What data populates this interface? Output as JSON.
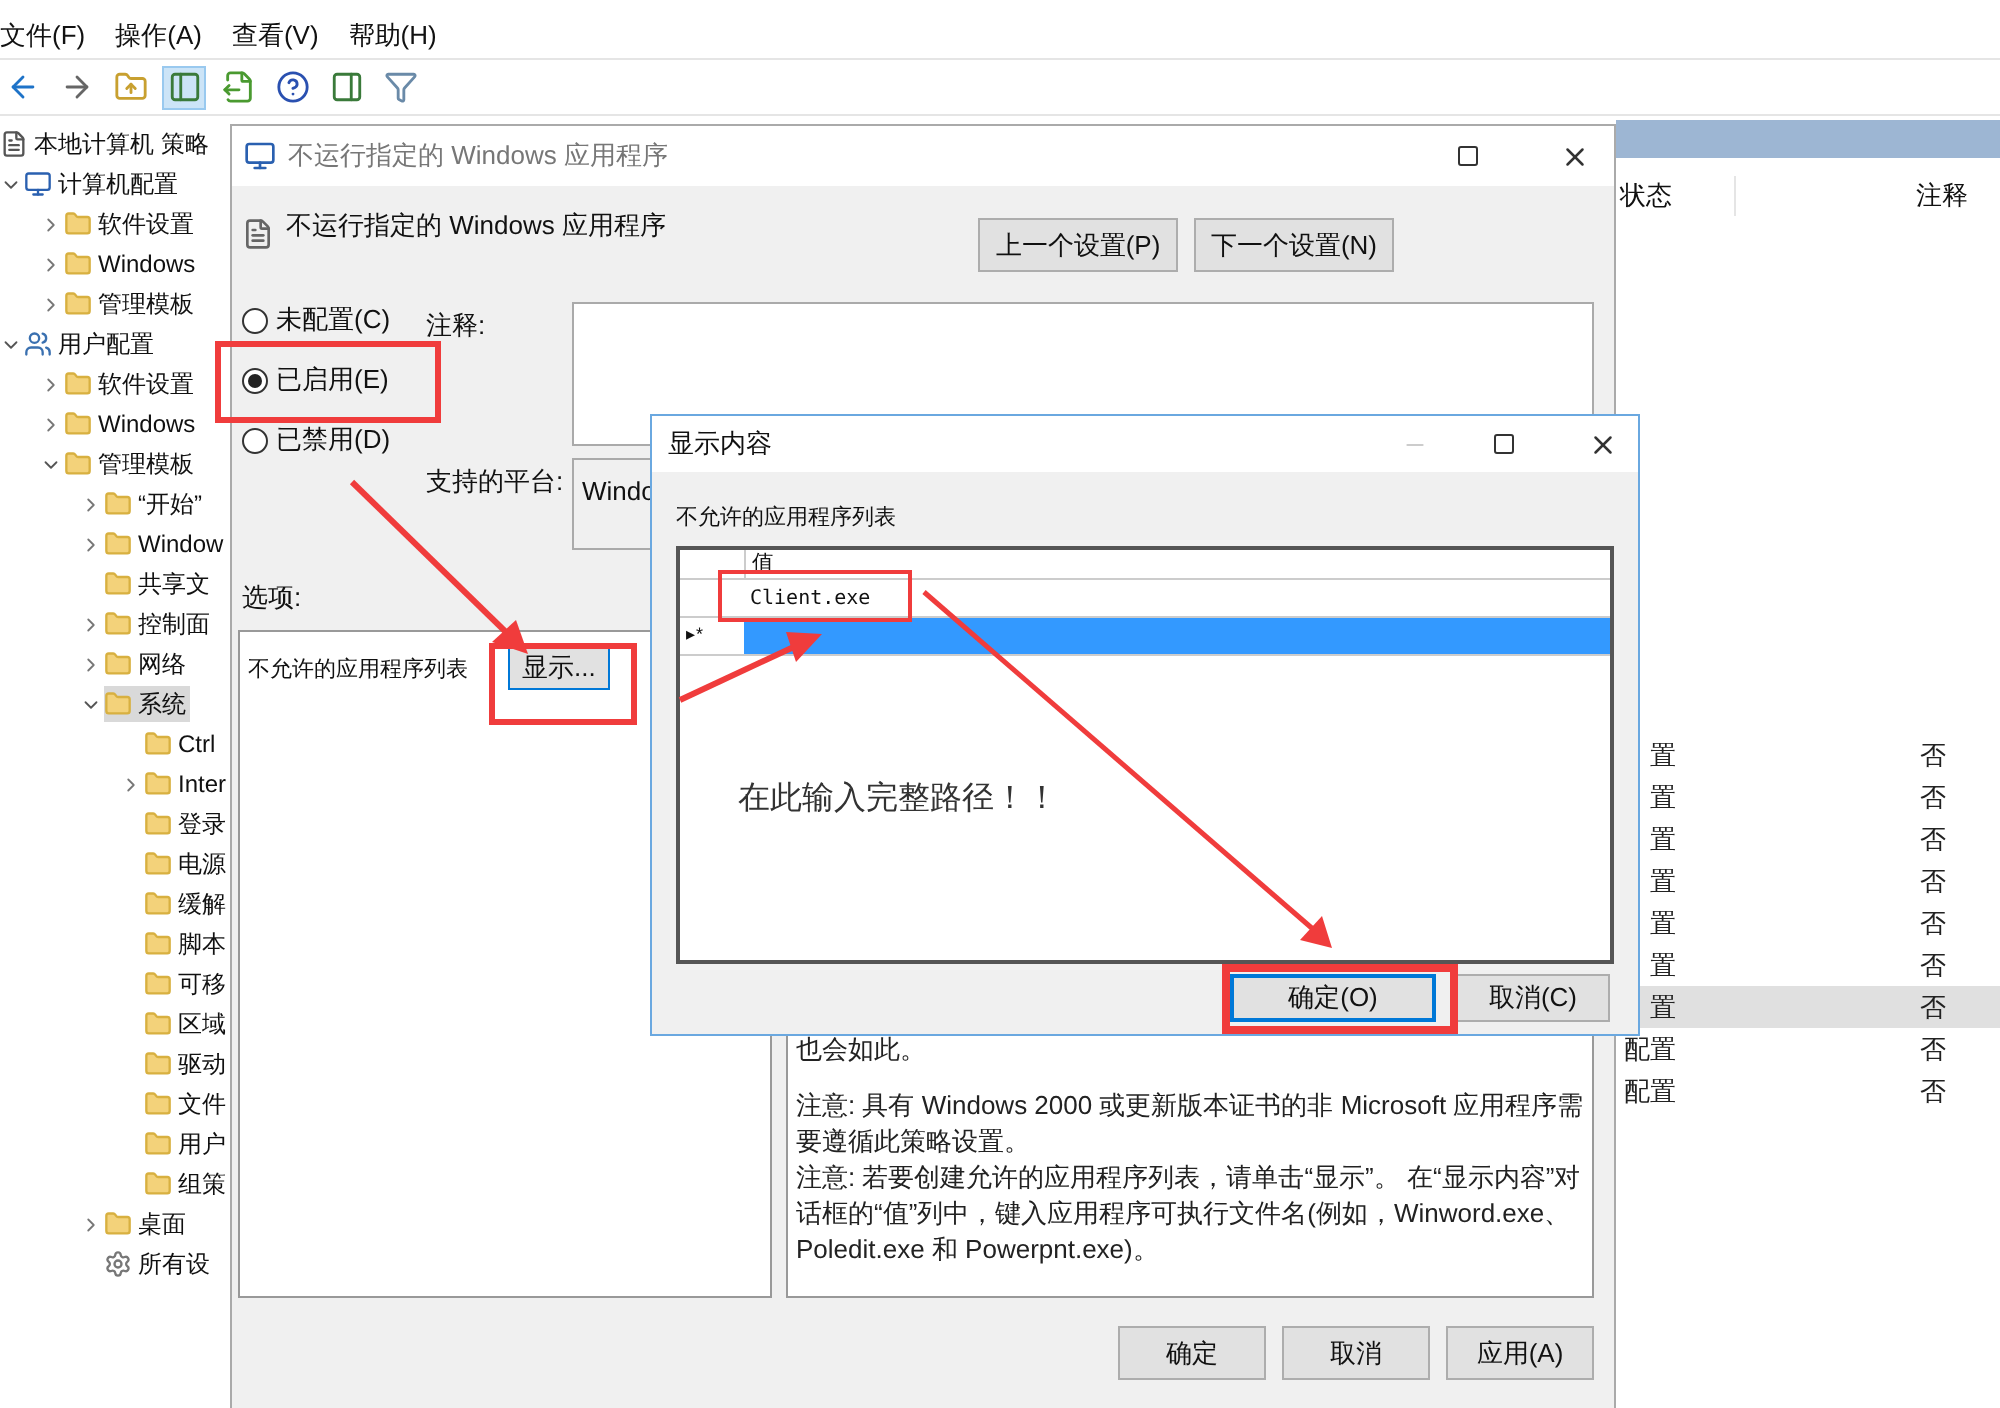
{
  "menu": [
    {
      "label": "文件(F)"
    },
    {
      "label": "操作(A)"
    },
    {
      "label": "查看(V)"
    },
    {
      "label": "帮助(H)"
    }
  ],
  "toolbar": [
    {
      "kind": "back",
      "selected": false
    },
    {
      "kind": "forward",
      "selected": false
    },
    {
      "kind": "up",
      "selected": false
    },
    {
      "kind": "tree",
      "selected": true
    },
    {
      "kind": "export",
      "selected": false
    },
    {
      "kind": "help",
      "selected": false
    },
    {
      "kind": "pane",
      "selected": false
    },
    {
      "kind": "filter",
      "selected": false
    }
  ],
  "tree": [
    {
      "label": "本地计算机 策略",
      "kind": "policy",
      "selected": false,
      "children": [
        {
          "label": "计算机配置",
          "kind": "computer",
          "expanded": true,
          "selected": false,
          "children": [
            {
              "label": "软件设置",
              "kind": "folder",
              "expanded": false,
              "selected": false
            },
            {
              "label": "Windows",
              "kind": "folder",
              "expanded": false,
              "selected": false
            },
            {
              "label": "管理模板",
              "kind": "folder",
              "expanded": false,
              "selected": false
            }
          ]
        },
        {
          "label": "用户配置",
          "kind": "users",
          "expanded": true,
          "selected": false,
          "children": [
            {
              "label": "软件设置",
              "kind": "folder",
              "expanded": false,
              "selected": false
            },
            {
              "label": "Windows",
              "kind": "folder",
              "expanded": false,
              "selected": false
            },
            {
              "label": "管理模板",
              "kind": "folder",
              "expanded": true,
              "selected": false,
              "children": [
                {
                  "label": "“开始”",
                  "kind": "folder",
                  "expanded": false,
                  "selected": false
                },
                {
                  "label": "Window",
                  "kind": "folder",
                  "expanded": false,
                  "selected": false
                },
                {
                  "label": "共享文",
                  "kind": "folder",
                  "selected": false
                },
                {
                  "label": "控制面",
                  "kind": "folder",
                  "expanded": false,
                  "selected": false
                },
                {
                  "label": "网络",
                  "kind": "folder",
                  "expanded": false,
                  "selected": false
                },
                {
                  "label": "系统",
                  "kind": "folder",
                  "expanded": true,
                  "selected": true,
                  "children": [
                    {
                      "label": "Ctrl",
                      "kind": "folder",
                      "selected": false
                    },
                    {
                      "label": "Inter",
                      "kind": "folder",
                      "expanded": false,
                      "selected": false
                    },
                    {
                      "label": "登录",
                      "kind": "folder",
                      "selected": false
                    },
                    {
                      "label": "电源",
                      "kind": "folder",
                      "selected": false
                    },
                    {
                      "label": "缓解",
                      "kind": "folder",
                      "selected": false
                    },
                    {
                      "label": "脚本",
                      "kind": "folder",
                      "selected": false
                    },
                    {
                      "label": "可移",
                      "kind": "folder",
                      "selected": false
                    },
                    {
                      "label": "区域",
                      "kind": "folder",
                      "selected": false
                    },
                    {
                      "label": "驱动",
                      "kind": "folder",
                      "selected": false
                    },
                    {
                      "label": "文件",
                      "kind": "folder",
                      "selected": false
                    },
                    {
                      "label": "用户",
                      "kind": "folder",
                      "selected": false
                    },
                    {
                      "label": "组策",
                      "kind": "folder",
                      "selected": false
                    }
                  ]
                },
                {
                  "label": "桌面",
                  "kind": "folder",
                  "expanded": false,
                  "selected": false
                },
                {
                  "label": "所有设",
                  "kind": "settings",
                  "selected": false
                }
              ]
            }
          ]
        }
      ]
    }
  ],
  "details": {
    "columns": [
      "状态",
      "注释"
    ],
    "rows": [
      {
        "cells": [
          "置",
          "否"
        ],
        "selected": false
      },
      {
        "cells": [
          "置",
          "否"
        ],
        "selected": false
      },
      {
        "cells": [
          "置",
          "否"
        ],
        "selected": false
      },
      {
        "cells": [
          "置",
          "否"
        ],
        "selected": false
      },
      {
        "cells": [
          "置",
          "否"
        ],
        "selected": false
      },
      {
        "cells": [
          "置",
          "否"
        ],
        "selected": false
      },
      {
        "cells": [
          "置",
          "否"
        ],
        "selected": true
      },
      {
        "cells": [
          "配置",
          "否"
        ],
        "selected": false
      },
      {
        "cells": [
          "配置",
          "否"
        ],
        "selected": false
      }
    ]
  },
  "policy_dialog": {
    "title": "不运行指定的 Windows 应用程序",
    "heading": "不运行指定的 Windows 应用程序",
    "nav_buttons": [
      "上一个设置(P)",
      "下一个设置(N)"
    ],
    "radios": [
      {
        "label": "未配置(C)",
        "selected": false
      },
      {
        "label": "已启用(E)",
        "selected": true
      },
      {
        "label": "已禁用(D)",
        "selected": false
      }
    ],
    "comment_label": "注释:",
    "platform_label": "支持的平台:",
    "platform_value": "Windo",
    "options_label": "选项:",
    "option": {
      "label": "不允许的应用程序列表",
      "button": "显示..."
    },
    "help": [
      [
        "也会如此。"
      ],
      [
        "注意: 具有 Windows 2000 或更新版本证书的非 Microsoft 应用程序需要遵循此策略设置。",
        "注意: 若要创建允许的应用程序列表，请单击“显示”。 在“显示内容”对话框的“值”列中，键入应用程序可执行文件名(例如，Winword.exe、Poledit.exe 和 Powerpnt.exe)。"
      ]
    ],
    "buttons": [
      "确定",
      "取消",
      "应用(A)"
    ]
  },
  "show_dialog": {
    "title": "显示内容",
    "list_label": "不允许的应用程序列表",
    "column": "值",
    "rows": [
      {
        "value": "Client.exe",
        "selected": false
      },
      {
        "marker": "▸*",
        "selected": true
      }
    ],
    "note": "在此输入完整路径！！",
    "buttons": [
      {
        "label": "确定(O)",
        "focused": true
      },
      {
        "label": "取消(C)",
        "focused": false
      }
    ]
  }
}
